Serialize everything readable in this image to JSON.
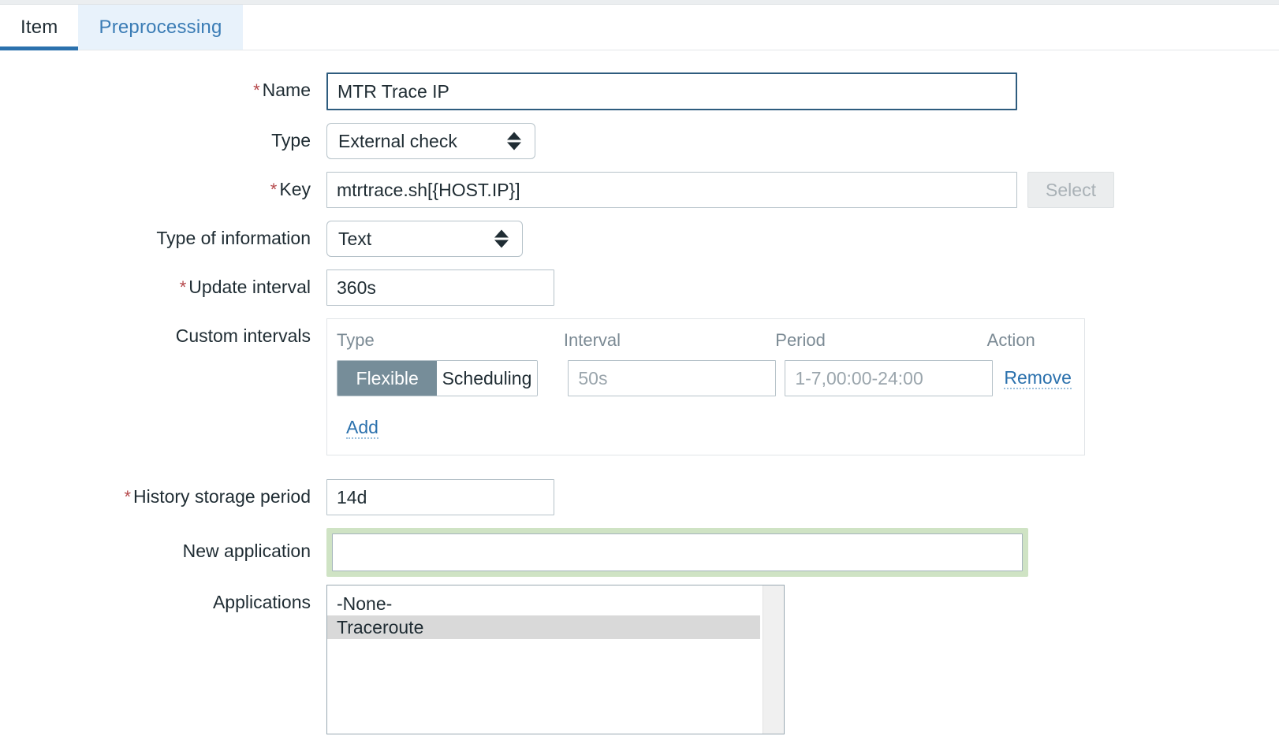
{
  "tabs": [
    {
      "label": "Item",
      "active": true
    },
    {
      "label": "Preprocessing",
      "active": false
    }
  ],
  "form": {
    "name": {
      "label": "Name",
      "required": "*",
      "value": "MTR Trace IP",
      "placeholder": ""
    },
    "type": {
      "label": "Type",
      "value": "External check"
    },
    "key": {
      "label": "Key",
      "required": "*",
      "value": "mtrtrace.sh[{HOST.IP}]",
      "placeholder": "",
      "select_button": "Select"
    },
    "type_of_information": {
      "label": "Type of information",
      "value": "Text"
    },
    "update_interval": {
      "label": "Update interval",
      "required": "*",
      "value": "360s"
    },
    "custom_intervals": {
      "label": "Custom intervals",
      "headers": {
        "type": "Type",
        "interval": "Interval",
        "period": "Period",
        "action": "Action"
      },
      "rows": [
        {
          "type_flexible": "Flexible",
          "type_scheduling": "Scheduling",
          "selected_type": "Flexible",
          "interval_value": "",
          "interval_placeholder": "50s",
          "period_value": "",
          "period_placeholder": "1-7,00:00-24:00",
          "action_label": "Remove"
        }
      ],
      "add_label": "Add"
    },
    "history_storage_period": {
      "label": "History storage period",
      "required": "*",
      "value": "14d"
    },
    "new_application": {
      "label": "New application",
      "value": "",
      "placeholder": ""
    },
    "applications": {
      "label": "Applications",
      "options": [
        {
          "label": "-None-",
          "selected": false
        },
        {
          "label": "Traceroute",
          "selected": true
        }
      ]
    }
  },
  "colors": {
    "accent": "#2b71ad",
    "required": "#b5484b",
    "toggle_on": "#768d99",
    "highlight_green": "#cfe3c4",
    "selected_row": "#d9d9d9"
  }
}
